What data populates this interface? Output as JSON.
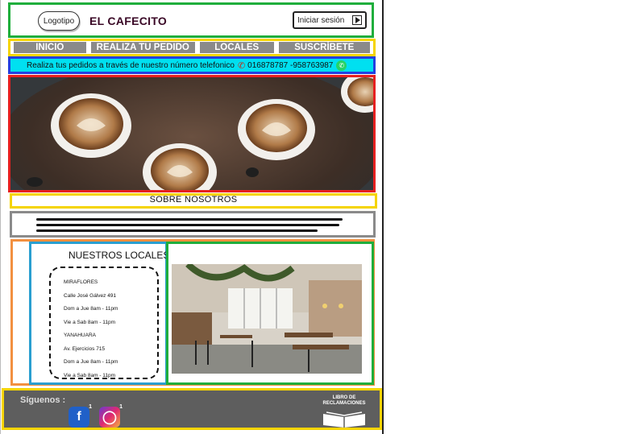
{
  "header": {
    "logo_label": "Logotipo",
    "brand": "EL CAFECITO",
    "login_label": "Iniciar sesión"
  },
  "nav": {
    "items": [
      {
        "label": "INICIO"
      },
      {
        "label": "REALIZA TU PEDIDO"
      },
      {
        "label": "LOCALES"
      },
      {
        "label": "SUSCRÍBETE"
      }
    ]
  },
  "phone_banner": {
    "text": "Realiza tus pedidos a través de nuestro número telefonico",
    "numbers": "016878787 -958763987",
    "phone_icon": "phone-icon",
    "whatsapp_icon": "whatsapp-icon"
  },
  "about": {
    "title": "SOBRE NOSOTROS"
  },
  "locales": {
    "title": "NUESTROS LOCALES",
    "lines": [
      "MIRAFLORES",
      "Calle José Gálvez 491",
      "Dom a Jue 8am - 11pm",
      "Vie a Sab 8am - 11pm",
      "YANAHUARA",
      "Av. Ejercicios 715",
      "Dom a Jue 8am - 11pm",
      "Vie a Sab 8am - 11pm"
    ]
  },
  "footer": {
    "follow_label": "Síguenos :",
    "facebook_icon": "facebook-icon",
    "instagram_icon": "instagram-icon",
    "book_label": "LIBRO DE RECLAMACIONES"
  },
  "colors": {
    "brand_text": "#3a0826",
    "nav_bg": "#8a8a8a",
    "banner_bg": "#00e0f0",
    "footer_bg": "#5e5e5e"
  }
}
